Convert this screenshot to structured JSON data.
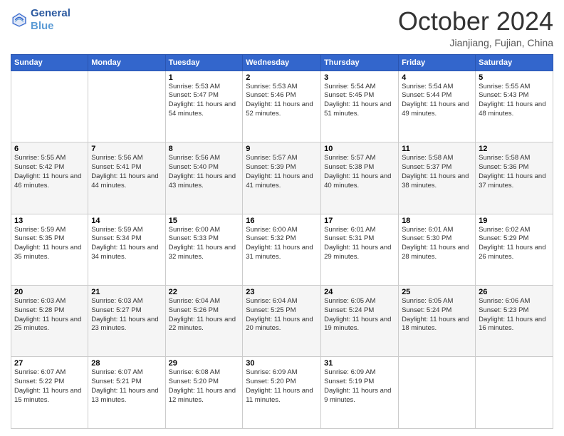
{
  "header": {
    "logo_line1": "General",
    "logo_line2": "Blue",
    "month": "October 2024",
    "location": "Jianjiang, Fujian, China"
  },
  "weekdays": [
    "Sunday",
    "Monday",
    "Tuesday",
    "Wednesday",
    "Thursday",
    "Friday",
    "Saturday"
  ],
  "weeks": [
    [
      {
        "day": "",
        "sunrise": "",
        "sunset": "",
        "daylight": ""
      },
      {
        "day": "",
        "sunrise": "",
        "sunset": "",
        "daylight": ""
      },
      {
        "day": "1",
        "sunrise": "Sunrise: 5:53 AM",
        "sunset": "Sunset: 5:47 PM",
        "daylight": "Daylight: 11 hours and 54 minutes."
      },
      {
        "day": "2",
        "sunrise": "Sunrise: 5:53 AM",
        "sunset": "Sunset: 5:46 PM",
        "daylight": "Daylight: 11 hours and 52 minutes."
      },
      {
        "day": "3",
        "sunrise": "Sunrise: 5:54 AM",
        "sunset": "Sunset: 5:45 PM",
        "daylight": "Daylight: 11 hours and 51 minutes."
      },
      {
        "day": "4",
        "sunrise": "Sunrise: 5:54 AM",
        "sunset": "Sunset: 5:44 PM",
        "daylight": "Daylight: 11 hours and 49 minutes."
      },
      {
        "day": "5",
        "sunrise": "Sunrise: 5:55 AM",
        "sunset": "Sunset: 5:43 PM",
        "daylight": "Daylight: 11 hours and 48 minutes."
      }
    ],
    [
      {
        "day": "6",
        "sunrise": "Sunrise: 5:55 AM",
        "sunset": "Sunset: 5:42 PM",
        "daylight": "Daylight: 11 hours and 46 minutes."
      },
      {
        "day": "7",
        "sunrise": "Sunrise: 5:56 AM",
        "sunset": "Sunset: 5:41 PM",
        "daylight": "Daylight: 11 hours and 44 minutes."
      },
      {
        "day": "8",
        "sunrise": "Sunrise: 5:56 AM",
        "sunset": "Sunset: 5:40 PM",
        "daylight": "Daylight: 11 hours and 43 minutes."
      },
      {
        "day": "9",
        "sunrise": "Sunrise: 5:57 AM",
        "sunset": "Sunset: 5:39 PM",
        "daylight": "Daylight: 11 hours and 41 minutes."
      },
      {
        "day": "10",
        "sunrise": "Sunrise: 5:57 AM",
        "sunset": "Sunset: 5:38 PM",
        "daylight": "Daylight: 11 hours and 40 minutes."
      },
      {
        "day": "11",
        "sunrise": "Sunrise: 5:58 AM",
        "sunset": "Sunset: 5:37 PM",
        "daylight": "Daylight: 11 hours and 38 minutes."
      },
      {
        "day": "12",
        "sunrise": "Sunrise: 5:58 AM",
        "sunset": "Sunset: 5:36 PM",
        "daylight": "Daylight: 11 hours and 37 minutes."
      }
    ],
    [
      {
        "day": "13",
        "sunrise": "Sunrise: 5:59 AM",
        "sunset": "Sunset: 5:35 PM",
        "daylight": "Daylight: 11 hours and 35 minutes."
      },
      {
        "day": "14",
        "sunrise": "Sunrise: 5:59 AM",
        "sunset": "Sunset: 5:34 PM",
        "daylight": "Daylight: 11 hours and 34 minutes."
      },
      {
        "day": "15",
        "sunrise": "Sunrise: 6:00 AM",
        "sunset": "Sunset: 5:33 PM",
        "daylight": "Daylight: 11 hours and 32 minutes."
      },
      {
        "day": "16",
        "sunrise": "Sunrise: 6:00 AM",
        "sunset": "Sunset: 5:32 PM",
        "daylight": "Daylight: 11 hours and 31 minutes."
      },
      {
        "day": "17",
        "sunrise": "Sunrise: 6:01 AM",
        "sunset": "Sunset: 5:31 PM",
        "daylight": "Daylight: 11 hours and 29 minutes."
      },
      {
        "day": "18",
        "sunrise": "Sunrise: 6:01 AM",
        "sunset": "Sunset: 5:30 PM",
        "daylight": "Daylight: 11 hours and 28 minutes."
      },
      {
        "day": "19",
        "sunrise": "Sunrise: 6:02 AM",
        "sunset": "Sunset: 5:29 PM",
        "daylight": "Daylight: 11 hours and 26 minutes."
      }
    ],
    [
      {
        "day": "20",
        "sunrise": "Sunrise: 6:03 AM",
        "sunset": "Sunset: 5:28 PM",
        "daylight": "Daylight: 11 hours and 25 minutes."
      },
      {
        "day": "21",
        "sunrise": "Sunrise: 6:03 AM",
        "sunset": "Sunset: 5:27 PM",
        "daylight": "Daylight: 11 hours and 23 minutes."
      },
      {
        "day": "22",
        "sunrise": "Sunrise: 6:04 AM",
        "sunset": "Sunset: 5:26 PM",
        "daylight": "Daylight: 11 hours and 22 minutes."
      },
      {
        "day": "23",
        "sunrise": "Sunrise: 6:04 AM",
        "sunset": "Sunset: 5:25 PM",
        "daylight": "Daylight: 11 hours and 20 minutes."
      },
      {
        "day": "24",
        "sunrise": "Sunrise: 6:05 AM",
        "sunset": "Sunset: 5:24 PM",
        "daylight": "Daylight: 11 hours and 19 minutes."
      },
      {
        "day": "25",
        "sunrise": "Sunrise: 6:05 AM",
        "sunset": "Sunset: 5:24 PM",
        "daylight": "Daylight: 11 hours and 18 minutes."
      },
      {
        "day": "26",
        "sunrise": "Sunrise: 6:06 AM",
        "sunset": "Sunset: 5:23 PM",
        "daylight": "Daylight: 11 hours and 16 minutes."
      }
    ],
    [
      {
        "day": "27",
        "sunrise": "Sunrise: 6:07 AM",
        "sunset": "Sunset: 5:22 PM",
        "daylight": "Daylight: 11 hours and 15 minutes."
      },
      {
        "day": "28",
        "sunrise": "Sunrise: 6:07 AM",
        "sunset": "Sunset: 5:21 PM",
        "daylight": "Daylight: 11 hours and 13 minutes."
      },
      {
        "day": "29",
        "sunrise": "Sunrise: 6:08 AM",
        "sunset": "Sunset: 5:20 PM",
        "daylight": "Daylight: 11 hours and 12 minutes."
      },
      {
        "day": "30",
        "sunrise": "Sunrise: 6:09 AM",
        "sunset": "Sunset: 5:20 PM",
        "daylight": "Daylight: 11 hours and 11 minutes."
      },
      {
        "day": "31",
        "sunrise": "Sunrise: 6:09 AM",
        "sunset": "Sunset: 5:19 PM",
        "daylight": "Daylight: 11 hours and 9 minutes."
      },
      {
        "day": "",
        "sunrise": "",
        "sunset": "",
        "daylight": ""
      },
      {
        "day": "",
        "sunrise": "",
        "sunset": "",
        "daylight": ""
      }
    ]
  ]
}
